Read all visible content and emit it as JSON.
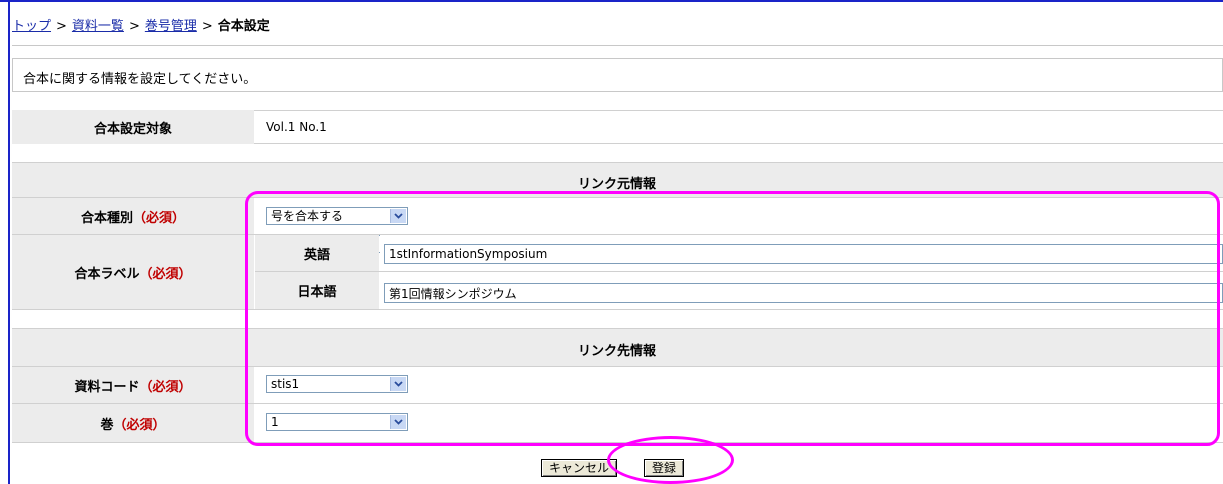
{
  "breadcrumb": {
    "items": [
      "トップ",
      "資料一覧",
      "巻号管理"
    ],
    "separator": ">",
    "current": "合本設定"
  },
  "notice": "合本に関する情報を設定してください。",
  "target": {
    "label": "合本設定対象",
    "value": "Vol.1 No.1"
  },
  "link_source": {
    "header": "リンク元情報",
    "type": {
      "label": "合本種別",
      "required": "（必須）",
      "selected": "号を合本する"
    },
    "label": {
      "label": "合本ラベル",
      "required": "（必須）",
      "english": {
        "label": "英語",
        "value": "1stInformationSymposium"
      },
      "japanese": {
        "label": "日本語",
        "value": "第1回情報シンポジウム"
      }
    }
  },
  "link_target": {
    "header": "リンク先情報",
    "code": {
      "label": "資料コード",
      "required": "（必須）",
      "selected": "stis1"
    },
    "volume": {
      "label": "巻",
      "required": "（必須）",
      "selected": "1"
    }
  },
  "buttons": {
    "cancel": "キャンセル",
    "register": "登録"
  },
  "colors": {
    "link": "#1a2ca8",
    "required": "#c00000",
    "label_bg": "#ececec",
    "highlight": "#ff00ff",
    "frame": "#1a24c8"
  },
  "icons": {
    "dropdown": "chevron-down-icon"
  }
}
